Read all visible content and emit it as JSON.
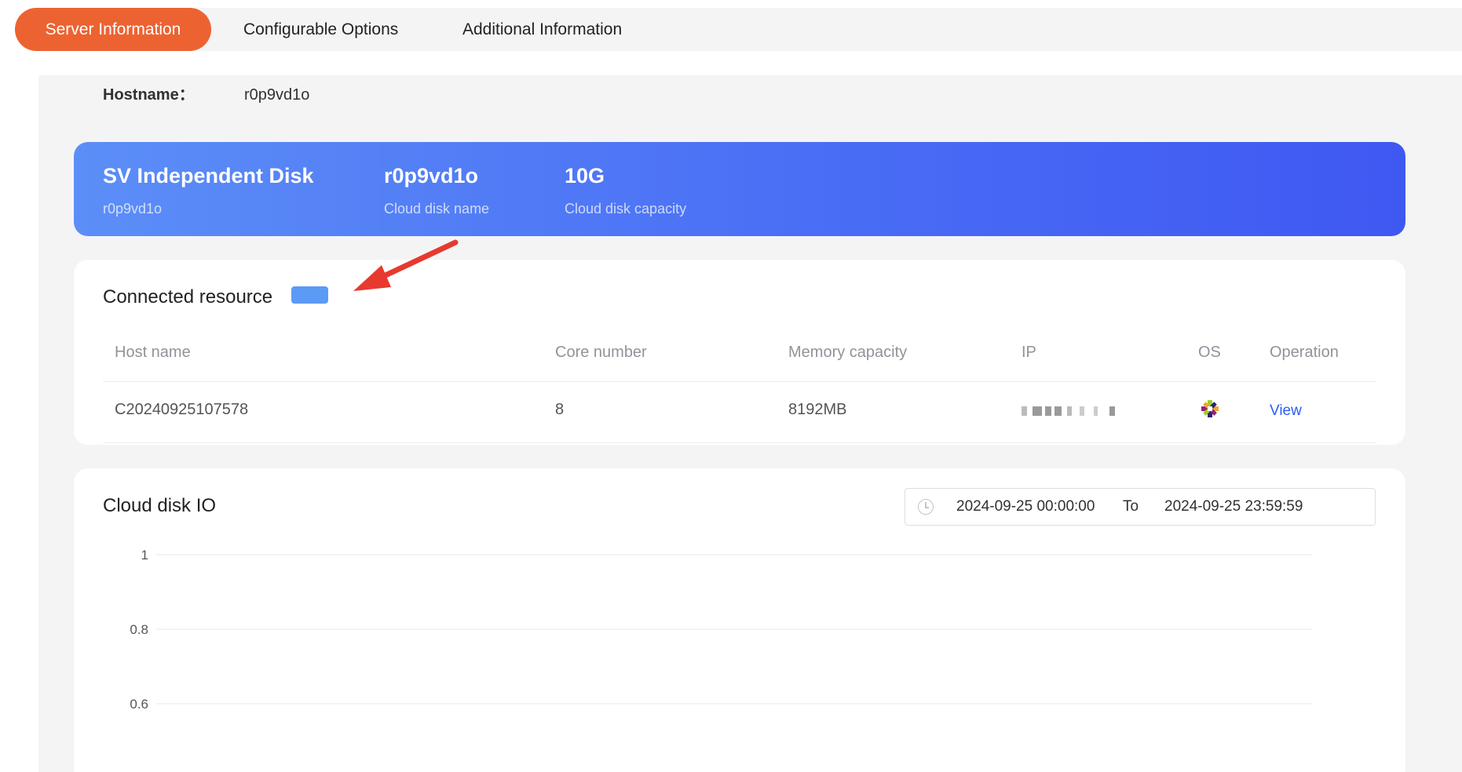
{
  "tabs": [
    {
      "label": "Server Information",
      "active": true
    },
    {
      "label": "Configurable Options",
      "active": false
    },
    {
      "label": "Additional Information",
      "active": false
    }
  ],
  "hostname": {
    "label": "Hostname：",
    "value": "r0p9vd1o"
  },
  "banner": {
    "product": {
      "value": "SV Independent Disk",
      "sub": "r0p9vd1o"
    },
    "disk_name": {
      "value": "r0p9vd1o",
      "label": "Cloud disk name"
    },
    "capacity": {
      "value": "10G",
      "label": "Cloud disk capacity"
    },
    "colors": {
      "start": "#5c8ef7",
      "end": "#3f58f2"
    }
  },
  "connected": {
    "title": "Connected resource",
    "badge_color": "#5b9bf5",
    "columns": [
      "Host name",
      "Core number",
      "Memory capacity",
      "IP",
      "OS",
      "Operation"
    ],
    "rows": [
      {
        "host": "C20240925107578",
        "cores": "8",
        "memory": "8192MB",
        "ip": "",
        "os_icon": "centos-icon",
        "operation": "View"
      }
    ]
  },
  "io": {
    "title": "Cloud disk IO",
    "range": {
      "start": "2024-09-25 00:00:00",
      "separator": "To",
      "end": "2024-09-25 23:59:59"
    }
  },
  "chart_data": {
    "type": "line",
    "series": [],
    "yticks": [
      "1",
      "0.8",
      "0.6"
    ],
    "grid": true
  },
  "accent": "#ec6331",
  "annotation": {
    "type": "red-arrow",
    "color": "#e8392f"
  }
}
